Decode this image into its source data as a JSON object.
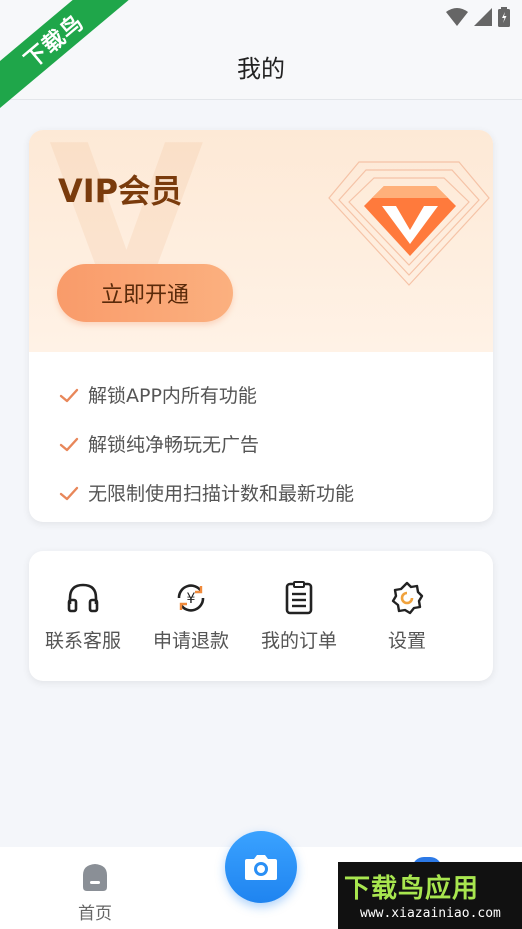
{
  "header": {
    "title": "我的"
  },
  "watermark_ribbon": {
    "text": "下载鸟"
  },
  "vip": {
    "title": "VIP会员",
    "button": "立即开通",
    "benefits": [
      "解锁APP内所有功能",
      "解锁纯净畅玩无广告",
      "无限制使用扫描计数和最新功能"
    ]
  },
  "menu": {
    "items": [
      {
        "label": "联系客服",
        "icon": "headset-icon"
      },
      {
        "label": "申请退款",
        "icon": "refund-icon"
      },
      {
        "label": "我的订单",
        "icon": "order-icon"
      },
      {
        "label": "设置",
        "icon": "gear-icon"
      }
    ]
  },
  "tabbar": {
    "home_label": "首页"
  },
  "brand": {
    "title": "下载鸟应用",
    "url": "www.xiazainiao.com"
  },
  "colors": {
    "accent": "#1f84f0",
    "vip_text": "#7a3b0c",
    "vip_button": "#f99b6a",
    "check": "#e8875a"
  }
}
